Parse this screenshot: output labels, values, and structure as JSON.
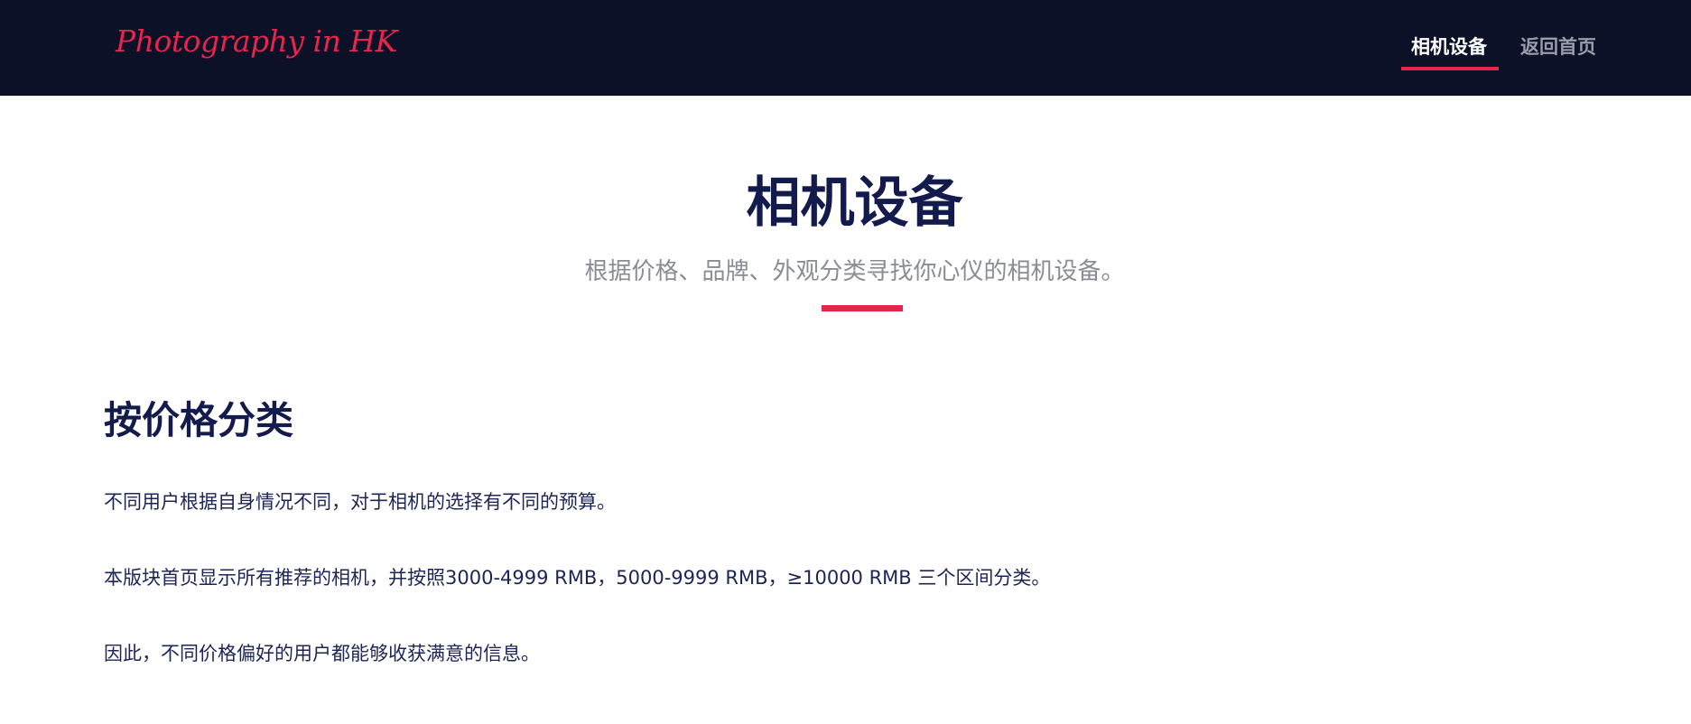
{
  "navbar": {
    "logo_text": "Photography in HK",
    "links": [
      {
        "label": "相机设备",
        "active": true
      },
      {
        "label": "返回首页",
        "active": false
      }
    ]
  },
  "hero": {
    "title": "相机设备",
    "subtitle": "根据价格、品牌、外观分类寻找你心仪的相机设备。"
  },
  "section": {
    "title": "按价格分类",
    "paragraphs": [
      "不同用户根据自身情况不同，对于相机的选择有不同的预算。",
      "本版块首页显示所有推荐的相机，并按照3000-4999 RMB，5000-9999 RMB，≥10000 RMB 三个区间分类。",
      "因此，不同价格偏好的用户都能够收获满意的信息。"
    ]
  },
  "colors": {
    "navbar_bg": "#0c1128",
    "accent": "#e5264a",
    "heading": "#131b4d",
    "muted": "#8a8c96"
  }
}
